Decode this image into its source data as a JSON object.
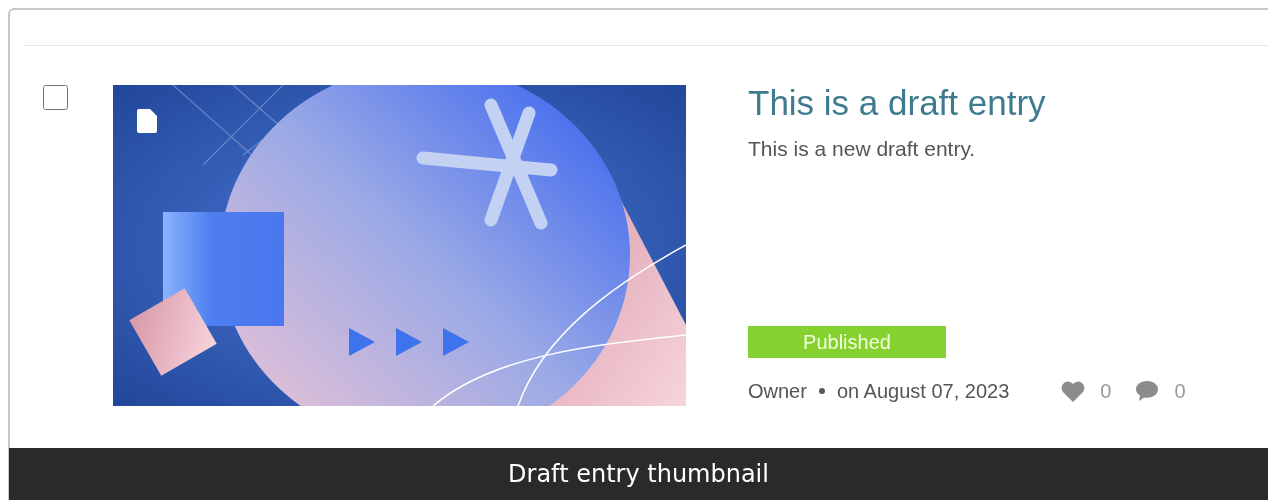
{
  "entry": {
    "checked": false,
    "title": "This is a draft entry",
    "description": "This is a new draft entry.",
    "status": {
      "label": "Published",
      "kind": "published"
    },
    "author": "Owner",
    "date": "on August 07, 2023",
    "likes": "0",
    "comments": "0"
  },
  "caption": "Draft entry thumbnail"
}
